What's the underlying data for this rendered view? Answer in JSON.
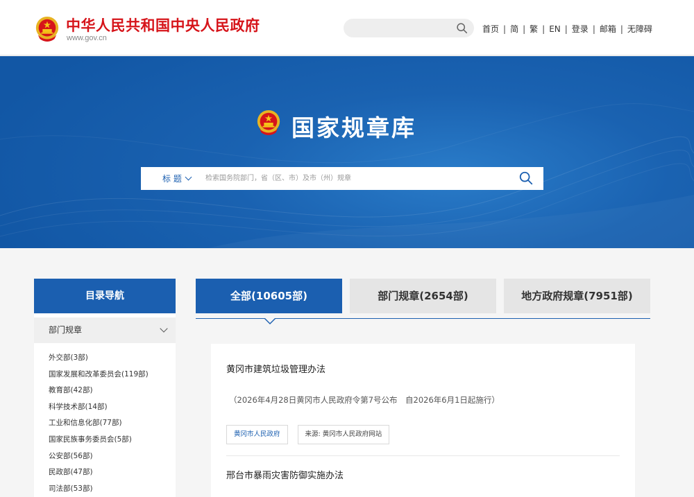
{
  "header": {
    "site_title": "中华人民共和国中央人民政府",
    "site_url": "www.gov.cn",
    "links": [
      "首页",
      "简",
      "繁",
      "EN",
      "登录",
      "邮箱",
      "无障碍"
    ],
    "colors": {
      "brand_red": "#d6141a"
    }
  },
  "banner": {
    "title": "国家规章库",
    "search": {
      "category": "标  题",
      "placeholder": "检索国务院部门，省（区、市）及市（州）规章"
    },
    "colors": {
      "banner_blue": "#1a62b1"
    }
  },
  "sidebar": {
    "heading": "目录导航",
    "section": "部门规章",
    "items": [
      "外交部(3部)",
      "国家发展和改革委员会(119部)",
      "教育部(42部)",
      "科学技术部(14部)",
      "工业和信息化部(77部)",
      "国家民族事务委员会(5部)",
      "公安部(56部)",
      "民政部(47部)",
      "司法部(53部)"
    ]
  },
  "tabs": [
    {
      "label": "全部(10605部)",
      "active": true
    },
    {
      "label": "部门规章(2654部)",
      "active": false
    },
    {
      "label": "地方政府规章(7951部)",
      "active": false
    }
  ],
  "results": [
    {
      "title": "黄冈市建筑垃圾管理办法",
      "meta": "（2026年4月28日黄冈市人民政府令第7号公布　自2026年6月1日起施行）",
      "tag_org": "黄冈市人民政府",
      "tag_source": "来源: 黄冈市人民政府网站"
    },
    {
      "title": "邢台市暴雨灾害防御实施办法"
    }
  ],
  "colors": {
    "accent": "#1b5fb0"
  }
}
